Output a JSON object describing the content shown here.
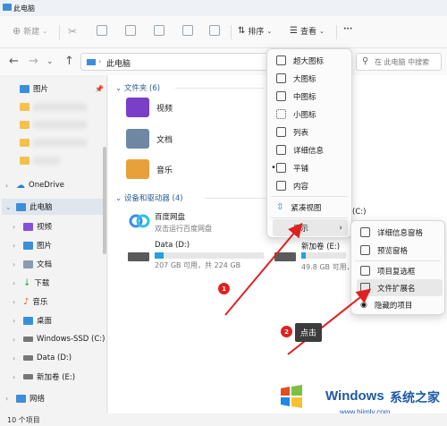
{
  "window": {
    "title": "此电脑"
  },
  "toolbar": {
    "new_label": "新建",
    "sort_label": "排序",
    "view_label": "查看",
    "more_label": "···"
  },
  "address": {
    "path": "此电脑",
    "search_placeholder": "在 此电脑 中搜索"
  },
  "sidebar": {
    "items": [
      {
        "label": "图片"
      },
      {
        "label": "OneDrive"
      },
      {
        "label": "此电脑"
      },
      {
        "label": "视频"
      },
      {
        "label": "图片"
      },
      {
        "label": "文档"
      },
      {
        "label": "下载"
      },
      {
        "label": "音乐"
      },
      {
        "label": "桌面"
      },
      {
        "label": "Windows-SSD (C:)"
      },
      {
        "label": "Data (D:)"
      },
      {
        "label": "新加卷 (E:)"
      },
      {
        "label": "网络"
      }
    ]
  },
  "main": {
    "folders_header": "文件夹 (6)",
    "folders": [
      {
        "label": "视频"
      },
      {
        "label": "文档"
      },
      {
        "label": "音乐"
      }
    ],
    "devices_header": "设备和驱动器 (4)",
    "baidu": {
      "name": "百度网盘",
      "sub": "双击运行百度网盘"
    },
    "drive_d": {
      "name": "Data (D:)",
      "sub": "207 GB 可用，共 224 GB",
      "used_fraction": 0.08
    },
    "drive_e": {
      "name": "新加卷 (E:)",
      "sub": "49.8 GB 可用，共",
      "used_fraction": 0.1
    },
    "drive_c_peek": "(C:)"
  },
  "view_menu": {
    "items": [
      {
        "label": "超大图标"
      },
      {
        "label": "大图标"
      },
      {
        "label": "中图标"
      },
      {
        "label": "小图标"
      },
      {
        "label": "列表"
      },
      {
        "label": "详细信息"
      },
      {
        "label": "平铺"
      },
      {
        "label": "内容"
      },
      {
        "label": "紧凑视图"
      },
      {
        "label": "显示"
      }
    ],
    "selected": "平铺"
  },
  "show_submenu": {
    "items": [
      {
        "label": "详细信息窗格"
      },
      {
        "label": "预览窗格"
      },
      {
        "label": "项目复选框"
      },
      {
        "label": "文件扩展名"
      },
      {
        "label": "隐藏的项目"
      }
    ]
  },
  "annotations": {
    "step1": "1",
    "step2": "2",
    "tooltip": "点击"
  },
  "status": {
    "count": "10 个项目"
  },
  "watermark": {
    "brand": "Windows",
    "cn": "系统之家",
    "url": "www.bjjmlv.com"
  },
  "colors": {
    "accent": "#26a0da",
    "arrow": "#e02020"
  }
}
